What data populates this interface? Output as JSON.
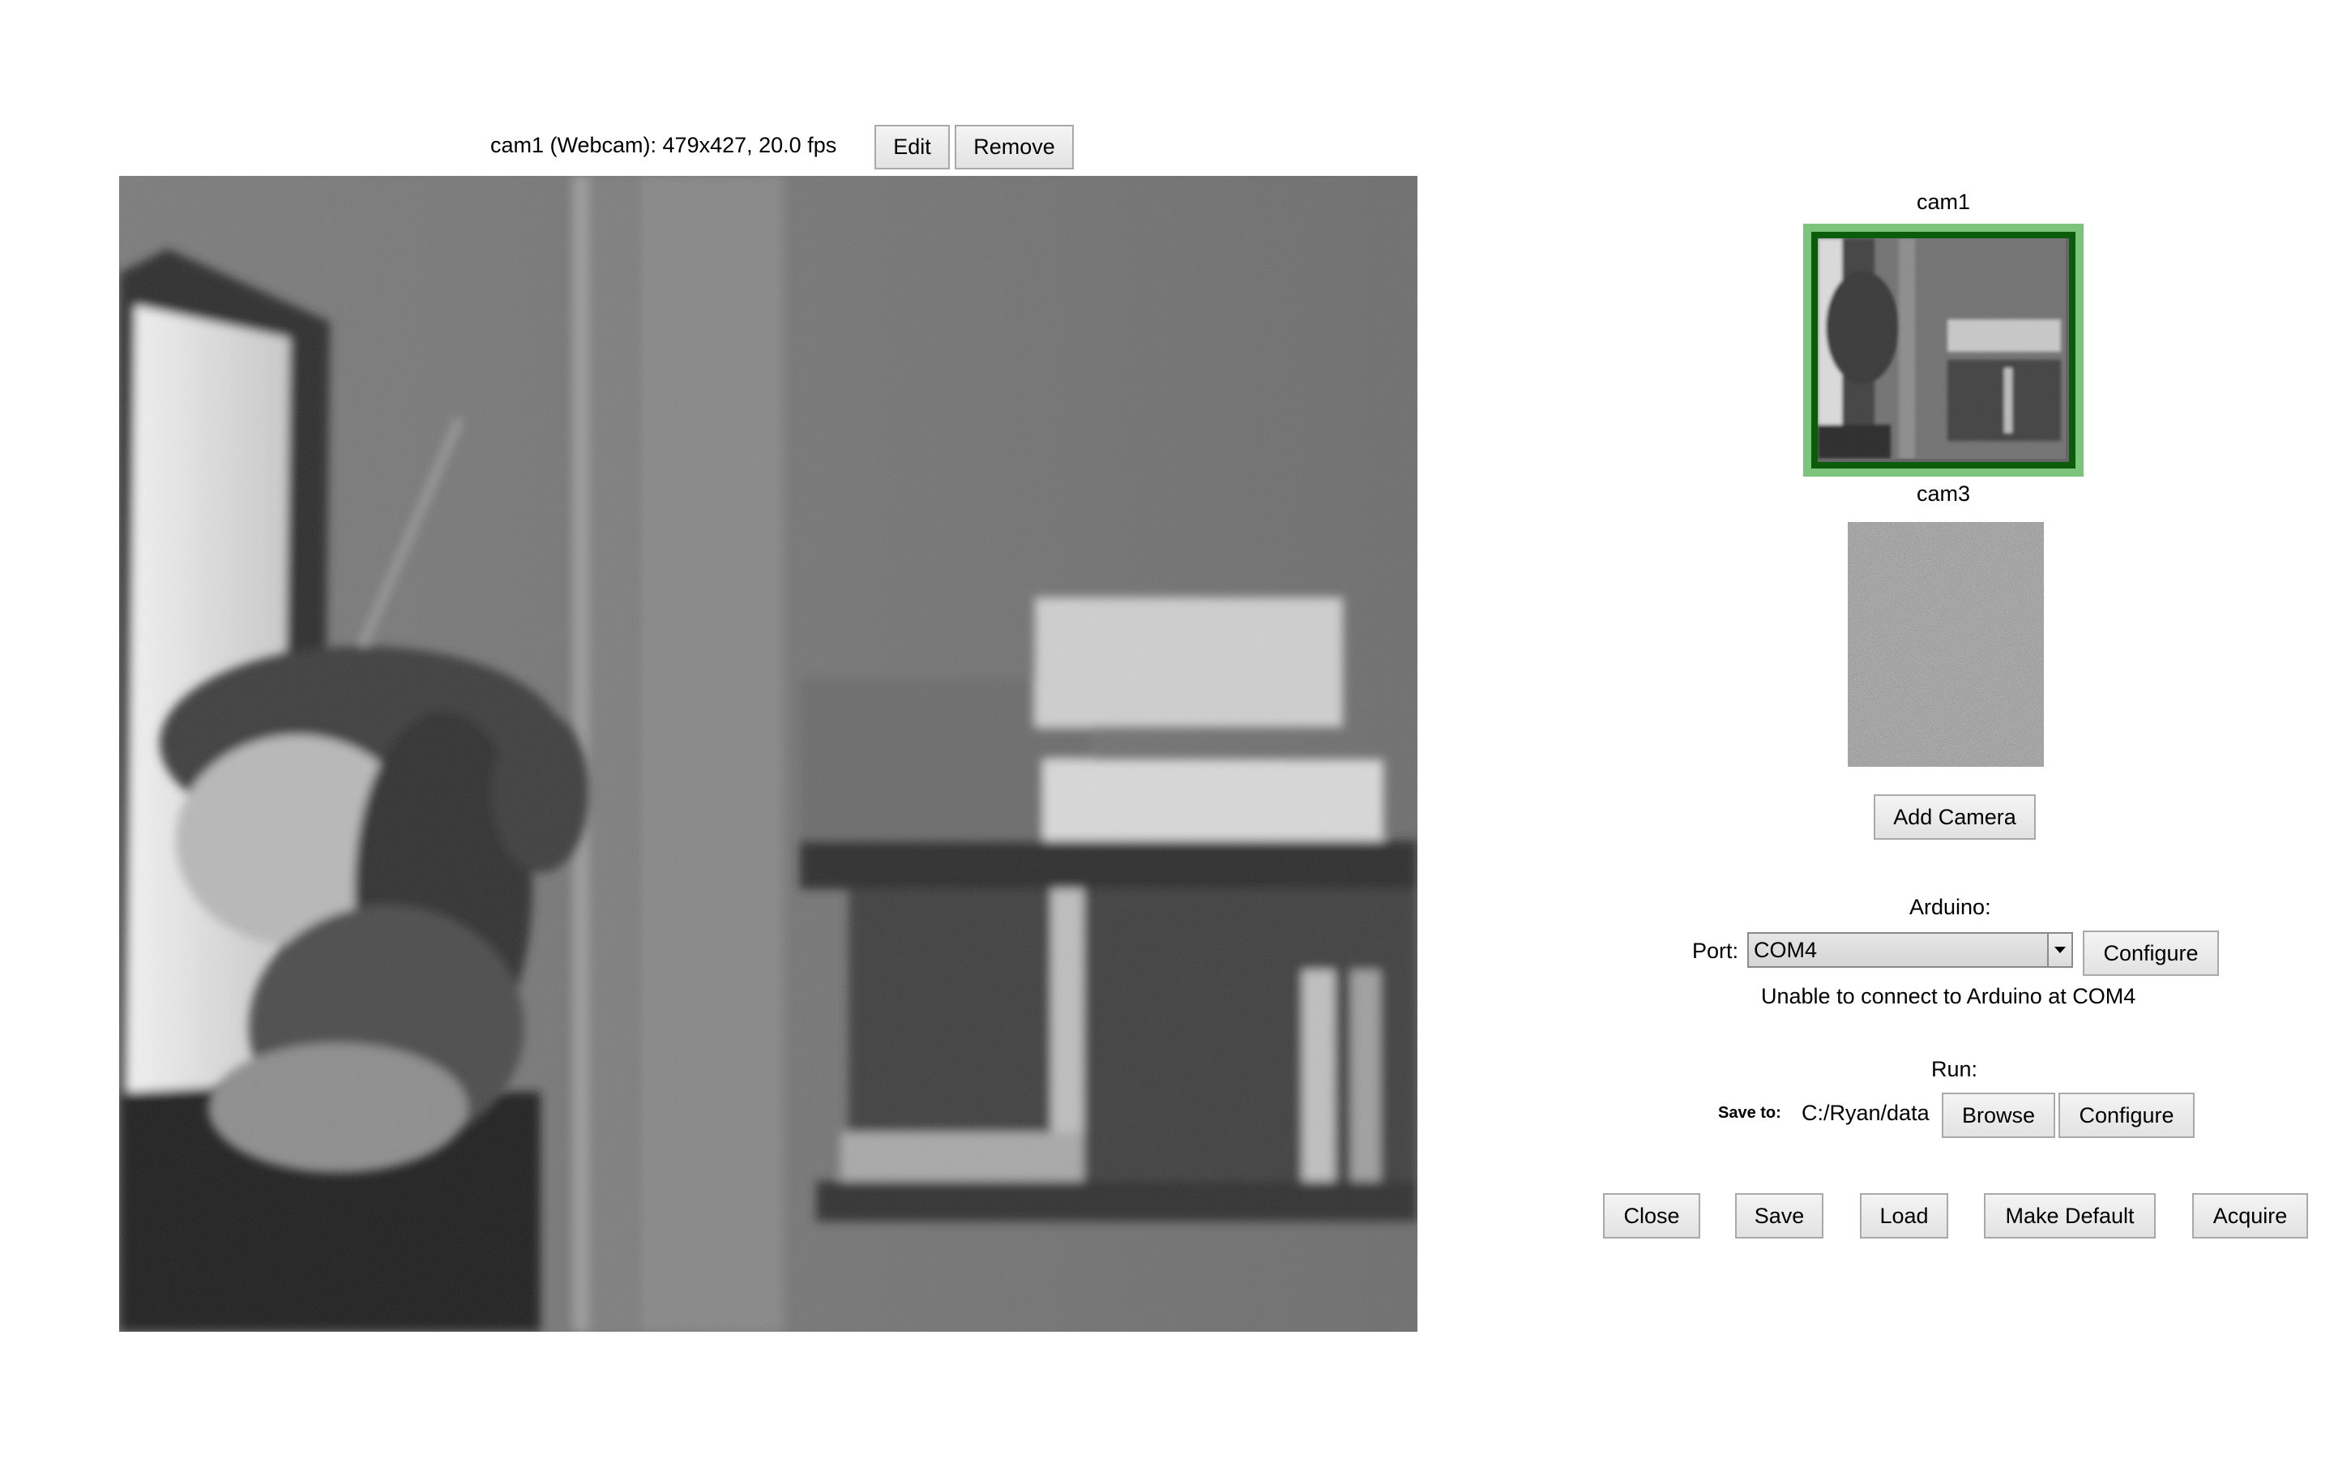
{
  "camera_header": {
    "info": "cam1 (Webcam): 479x427, 20.0 fps",
    "edit_label": "Edit",
    "remove_label": "Remove"
  },
  "camera_list": [
    {
      "name": "cam1",
      "selected": true
    },
    {
      "name": "cam3",
      "selected": false
    }
  ],
  "add_camera_label": "Add Camera",
  "arduino": {
    "heading": "Arduino:",
    "port_label": "Port:",
    "port_value": "COM4",
    "configure_label": "Configure",
    "status": "Unable to connect to Arduino at COM4"
  },
  "run": {
    "heading": "Run:",
    "save_to_label": "Save to:",
    "save_path": "C:/Ryan/data",
    "browse_label": "Browse",
    "configure_label": "Configure"
  },
  "bottom_buttons": {
    "close": "Close",
    "save": "Save",
    "load": "Load",
    "make_default": "Make Default",
    "acquire": "Acquire"
  },
  "colors": {
    "selected_frame_outer": "#7cc47c",
    "selected_frame_inner": "#0b5d0b"
  }
}
